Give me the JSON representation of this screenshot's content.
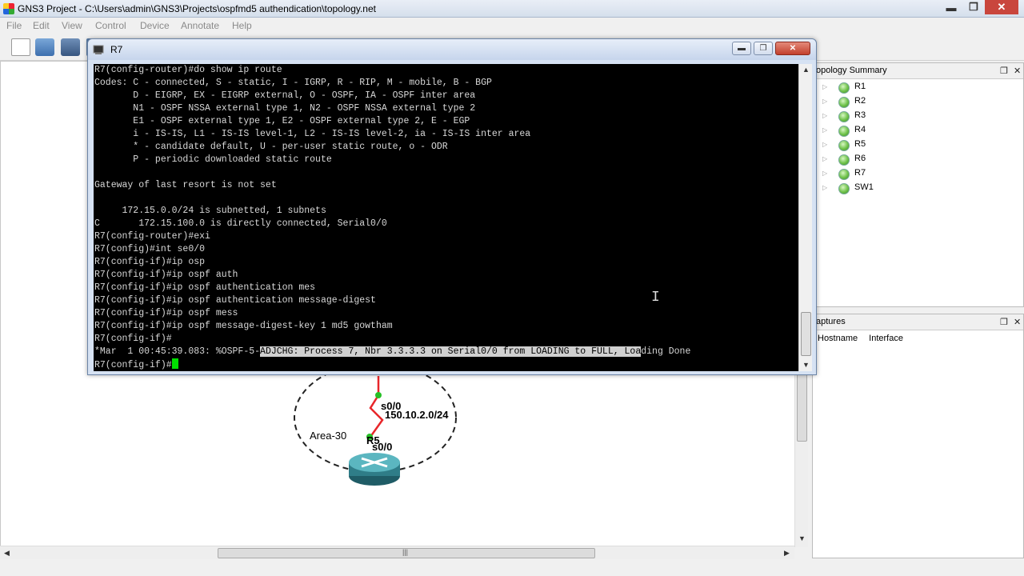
{
  "app": {
    "title": "GNS3 Project - C:\\Users\\admin\\GNS3\\Projects\\ospfmd5 authendication\\topology.net"
  },
  "menu": [
    "File",
    "Edit",
    "View",
    "Control",
    "Device",
    "Annotate",
    "Help"
  ],
  "toolbar": {
    "icons": [
      "new-project-icon",
      "open-project-icon",
      "save-project-icon",
      "snapshot-icon",
      "screenshot-icon",
      "topology-icon",
      "console-icon",
      "start-icon",
      "suspend-icon",
      "stop-icon",
      "reload-icon",
      "add-note-icon",
      "insert-image-icon",
      "draw-rectangle-icon",
      "draw-ellipse-icon"
    ]
  },
  "console": {
    "title": "R7",
    "lines": [
      "R7(config-router)#do show ip route",
      "Codes: C - connected, S - static, I - IGRP, R - RIP, M - mobile, B - BGP",
      "       D - EIGRP, EX - EIGRP external, O - OSPF, IA - OSPF inter area",
      "       N1 - OSPF NSSA external type 1, N2 - OSPF NSSA external type 2",
      "       E1 - OSPF external type 1, E2 - OSPF external type 2, E - EGP",
      "       i - IS-IS, L1 - IS-IS level-1, L2 - IS-IS level-2, ia - IS-IS inter area",
      "       * - candidate default, U - per-user static route, o - ODR",
      "       P - periodic downloaded static route",
      "",
      "Gateway of last resort is not set",
      "",
      "     172.15.0.0/24 is subnetted, 1 subnets",
      "C       172.15.100.0 is directly connected, Serial0/0",
      "R7(config-router)#exi",
      "R7(config)#int se0/0",
      "R7(config-if)#ip osp",
      "R7(config-if)#ip ospf auth",
      "R7(config-if)#ip ospf authentication mes",
      "R7(config-if)#ip ospf authentication message-digest",
      "R7(config-if)#ip ospf mess",
      "R7(config-if)#ip ospf message-digest-key 1 md5 gowtham",
      "R7(config-if)#"
    ],
    "log_prefix": "*Mar  1 00:45:39.083: %OSPF-5-",
    "log_highlight": "ADJCHG: Process 7, Nbr 3.3.3.3 on Serial0/0 from LOADING to FULL, Loa",
    "log_suffix": "ding Done",
    "prompt": "R7(config-if)#"
  },
  "topology_summary": {
    "title": "opology Summary",
    "devices": [
      "R1",
      "R2",
      "R3",
      "R4",
      "R5",
      "R6",
      "R7",
      "SW1"
    ]
  },
  "captures": {
    "title": "aptures",
    "columns": [
      "Hostname",
      "Interface"
    ]
  },
  "diagram": {
    "area_label": "Area-30",
    "router_label": "R5",
    "if_top": "s0/0",
    "if_bottom": "s0/0",
    "network": "150.10.2.0/24"
  },
  "colors": {
    "link": "#e8262a",
    "link_up": "#26c026",
    "router": "#3b8c96",
    "cursor": "#00e000"
  }
}
